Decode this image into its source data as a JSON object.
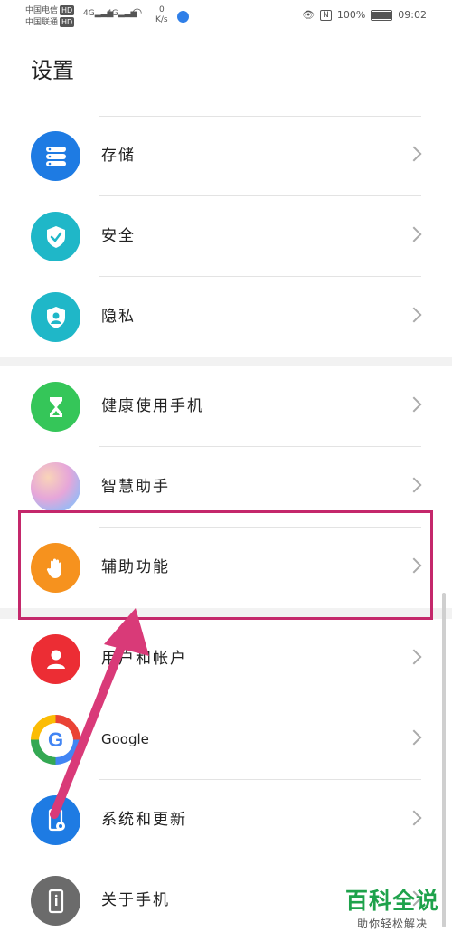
{
  "status_bar": {
    "carrier_1": "中国电信",
    "carrier_2": "中国联通",
    "hd": "HD",
    "signal_1": "4G",
    "signal_2": "4G",
    "speed_value": "0",
    "speed_unit": "K/s",
    "battery_text": "100%",
    "time": "09:02"
  },
  "page_title": "设置",
  "items": [
    {
      "label": "存储",
      "icon": "storage-icon",
      "color": "#1e7be3"
    },
    {
      "label": "安全",
      "icon": "shield-check-icon",
      "color": "#1fb7c8"
    },
    {
      "label": "隐私",
      "icon": "privacy-icon",
      "color": "#1fb7c8"
    },
    {
      "label": "健康使用手机",
      "icon": "hourglass-icon",
      "color": "#35c659"
    },
    {
      "label": "智慧助手",
      "icon": "assistant-orb-icon",
      "color": "#c8a7f0"
    },
    {
      "label": "辅助功能",
      "icon": "hand-icon",
      "color": "#f6921e"
    },
    {
      "label": "用户和帐户",
      "icon": "user-icon",
      "color": "#ec2d34"
    },
    {
      "label": "Google",
      "icon": "google-icon",
      "color": "#4285f4"
    },
    {
      "label": "系统和更新",
      "icon": "system-update-icon",
      "color": "#1e7be3"
    },
    {
      "label": "关于手机",
      "icon": "phone-info-icon",
      "color": "#6b6b6b"
    }
  ],
  "watermark": {
    "title": "百科全说",
    "subtitle": "助你轻松解决"
  },
  "colors": {
    "highlight_border": "#c4286b",
    "arrow": "#d93a78",
    "watermark_green": "#1ea24b"
  }
}
